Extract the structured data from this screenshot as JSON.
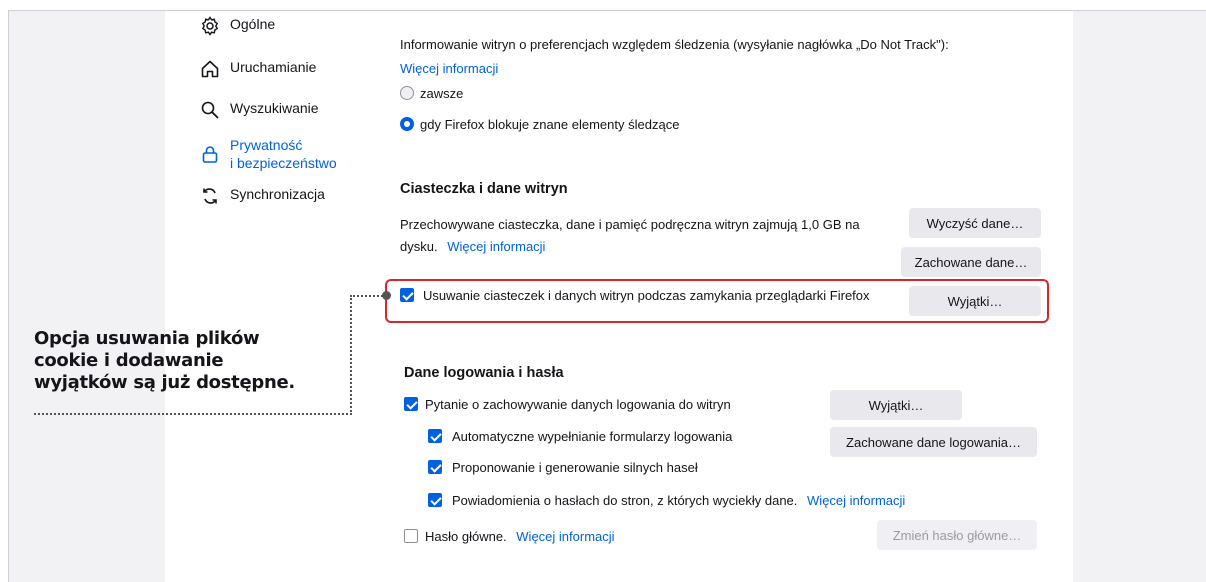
{
  "sidebar": {
    "items": [
      {
        "label": "Ogólne",
        "icon": "gear-icon"
      },
      {
        "label": "Uruchamianie",
        "icon": "home-icon"
      },
      {
        "label": "Wyszukiwanie",
        "icon": "search-icon"
      },
      {
        "label_line1": "Prywatność",
        "label_line2": "i bezpieczeństwo",
        "icon": "lock-icon",
        "active": true
      },
      {
        "label": "Synchronizacja",
        "icon": "sync-icon"
      }
    ]
  },
  "dnt": {
    "text": "Informowanie witryn o preferencjach względem śledzenia (wysyłanie nagłówka „Do Not Track\"):",
    "more_info": "Więcej informacji",
    "option_always": "zawsze",
    "option_blocking": "gdy Firefox blokuje znane elementy śledzące",
    "selected": "option_blocking"
  },
  "cookies": {
    "heading": "Ciasteczka i dane witryn",
    "storage_text_1": "Przechowywane ciasteczka, dane i pamięć podręczna witryn zajmują 1,0 GB na",
    "storage_text_2": "dysku.",
    "more_info": "Więcej informacji",
    "clear_button": "Wyczyść dane…",
    "manage_button": "Zachowane dane…",
    "delete_on_close_label": "Usuwanie ciasteczek i danych witryn podczas zamykania przeglądarki Firefox",
    "delete_on_close_checked": true,
    "exceptions_button": "Wyjątki…"
  },
  "callout": {
    "text": "Opcja usuwania plików cookie i dodawanie wyjątków są już dostępne."
  },
  "logins": {
    "heading": "Dane logowania i hasła",
    "ask_save_label": "Pytanie o zachowywanie danych logowania do witryn",
    "autofill_label": "Automatyczne wypełnianie formularzy logowania",
    "suggest_label": "Proponowanie i generowanie silnych haseł",
    "breach_label": "Powiadomienia o hasłach do stron, z których wyciekły dane.",
    "breach_more_info": "Więcej informacji",
    "master_password_label": "Hasło główne.",
    "master_more_info": "Więcej informacji",
    "exceptions_button": "Wyjątki…",
    "saved_logins_button": "Zachowane dane logowania…",
    "change_master_button": "Zmień hasło główne…"
  },
  "colors": {
    "accent": "#0061e0",
    "highlight": "#d7262c"
  }
}
